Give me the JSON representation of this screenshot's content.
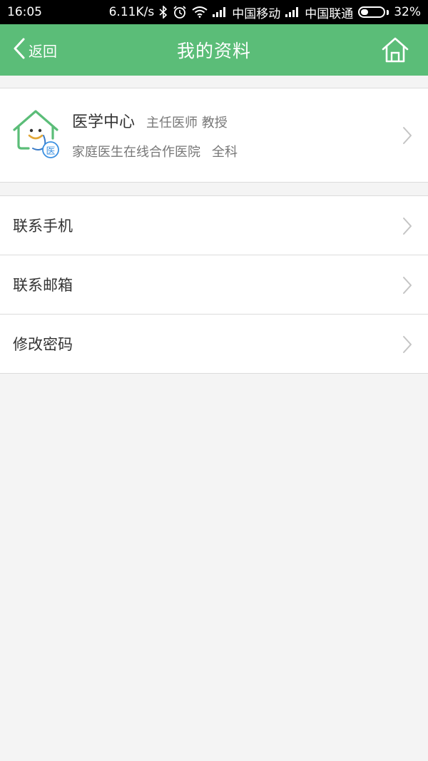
{
  "status_bar": {
    "time": "16:05",
    "net_speed": "6.11K/s",
    "carrier1": "中国移动",
    "carrier2": "中国联通",
    "battery": "32%",
    "battery_level": 0.32,
    "icons": [
      "bluetooth-icon",
      "alarm-icon",
      "wifi-icon",
      "signal-icon",
      "battery-icon"
    ]
  },
  "header": {
    "back_label": "返回",
    "title": "我的资料",
    "home_icon": "home-icon",
    "bg_color": "#5bbd78"
  },
  "profile": {
    "name": "医学中心",
    "position": "主任医师 教授",
    "hospital": "家庭医生在线合作医院",
    "department": "全科",
    "avatar_badge": "医",
    "avatar_icon": "doctor-house-logo-icon"
  },
  "menu": {
    "items": [
      {
        "label": "联系手机"
      },
      {
        "label": "联系邮箱"
      },
      {
        "label": "修改密码"
      }
    ]
  }
}
